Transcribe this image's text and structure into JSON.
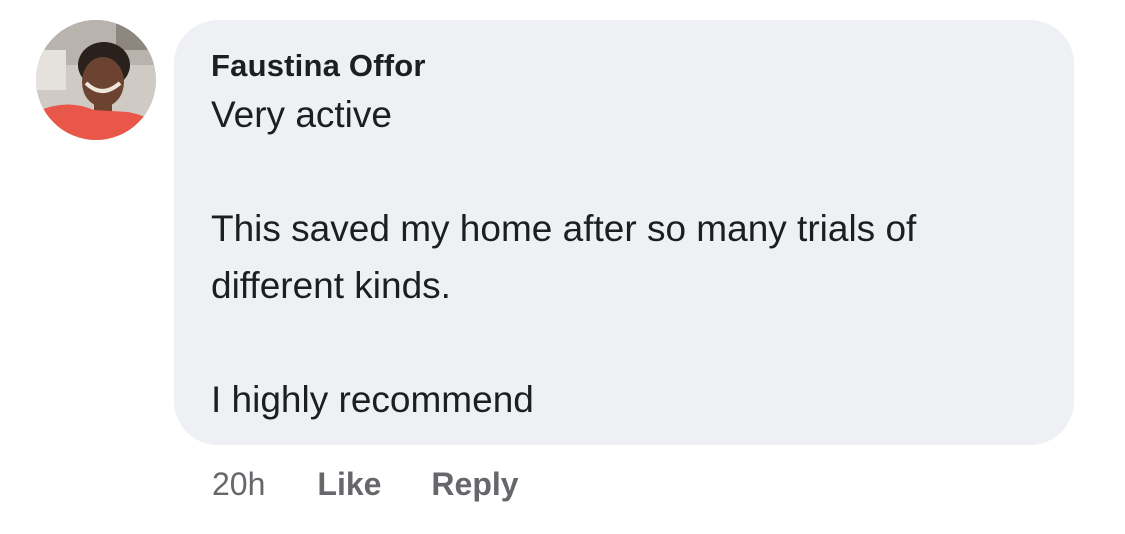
{
  "comment": {
    "author": "Faustina Offor",
    "lines": [
      "Very active",
      "",
      "This saved my home after so many trials of",
      "different kinds.",
      "",
      "I highly recommend"
    ]
  },
  "actions": {
    "time": "20h",
    "like_label": "Like",
    "reply_label": "Reply"
  }
}
